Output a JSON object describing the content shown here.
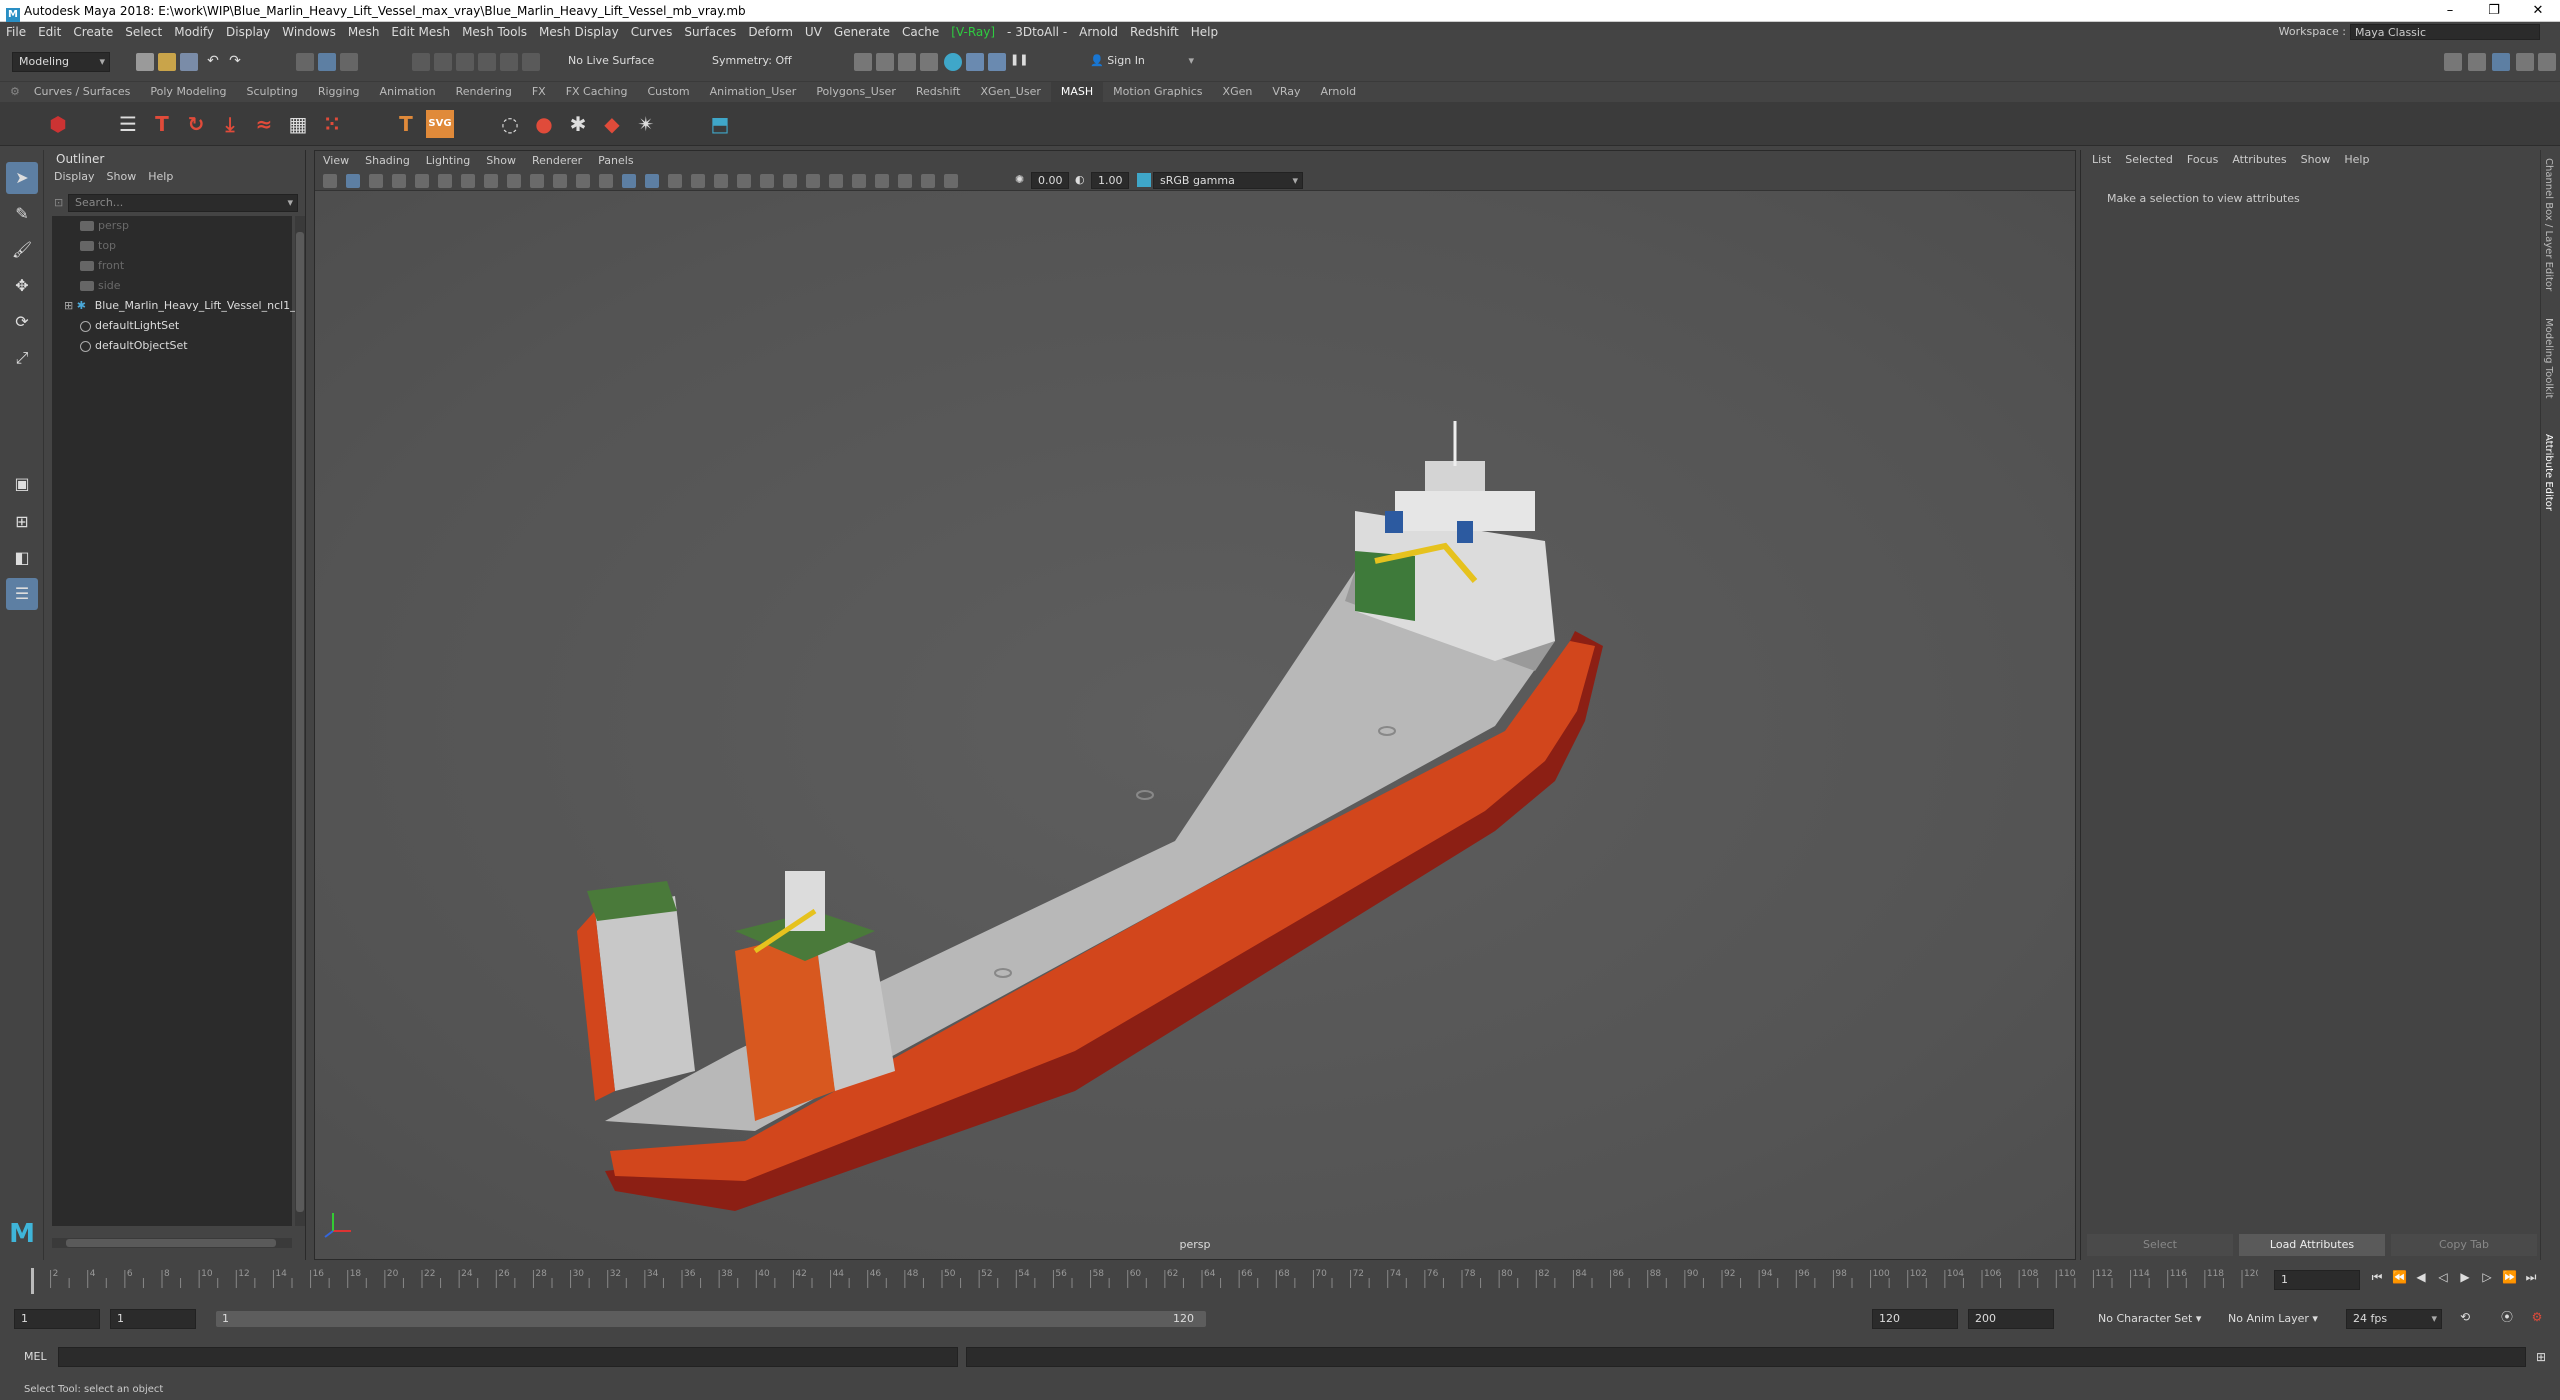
{
  "window": {
    "title": "Autodesk Maya 2018: E:\\work\\WIP\\Blue_Marlin_Heavy_Lift_Vessel_max_vray\\Blue_Marlin_Heavy_Lift_Vessel_mb_vray.mb",
    "minimize": "–",
    "restore": "❐",
    "close": "✕"
  },
  "menubar": {
    "items": [
      "File",
      "Edit",
      "Create",
      "Select",
      "Modify",
      "Display",
      "Windows",
      "Mesh",
      "Edit Mesh",
      "Mesh Tools",
      "Mesh Display",
      "Curves",
      "Surfaces",
      "Deform",
      "UV",
      "Generate",
      "Cache"
    ],
    "vray": "V-Ray",
    "items2": [
      "3DtoAll",
      "Arnold",
      "Redshift",
      "Help"
    ],
    "workspace_label": "Workspace :",
    "workspace_value": "Maya Classic"
  },
  "statusline": {
    "mode": "Modeling",
    "live_surface": "No Live Surface",
    "symmetry": "Symmetry: Off",
    "sign_in": "Sign In"
  },
  "shelf": {
    "tabs": [
      "Curves / Surfaces",
      "Poly Modeling",
      "Sculpting",
      "Rigging",
      "Animation",
      "Rendering",
      "FX",
      "FX Caching",
      "Custom",
      "Animation_User",
      "Polygons_User",
      "Redshift",
      "XGen_User",
      "MASH",
      "Motion Graphics",
      "XGen",
      "VRay",
      "Arnold"
    ],
    "active_tab": "MASH"
  },
  "outliner": {
    "title": "Outliner",
    "menu": [
      "Display",
      "Show",
      "Help"
    ],
    "search_placeholder": "Search...",
    "items": [
      {
        "label": "persp",
        "dim": true,
        "type": "camera"
      },
      {
        "label": "top",
        "dim": true,
        "type": "camera"
      },
      {
        "label": "front",
        "dim": true,
        "type": "camera"
      },
      {
        "label": "side",
        "dim": true,
        "type": "camera"
      },
      {
        "label": "Blue_Marlin_Heavy_Lift_Vessel_ncl1_1",
        "dim": false,
        "type": "group"
      },
      {
        "label": "defaultLightSet",
        "dim": false,
        "type": "set"
      },
      {
        "label": "defaultObjectSet",
        "dim": false,
        "type": "set"
      }
    ]
  },
  "viewport": {
    "menu": [
      "View",
      "Shading",
      "Lighting",
      "Show",
      "Renderer",
      "Panels"
    ],
    "exposure": "0.00",
    "gamma": "1.00",
    "color_space": "sRGB gamma",
    "camera": "persp"
  },
  "attribute_editor": {
    "menu": [
      "List",
      "Selected",
      "Focus",
      "Attributes",
      "Show",
      "Help"
    ],
    "message": "Make a selection to view attributes",
    "buttons": [
      "Select",
      "Load Attributes",
      "Copy Tab"
    ]
  },
  "side_tabs": [
    "Channel Box / Layer Editor",
    "Modeling Toolkit",
    "Attribute Editor"
  ],
  "timeline": {
    "tick_labels": [
      "2",
      "4",
      "6",
      "8",
      "10",
      "12",
      "14",
      "16",
      "18",
      "20",
      "22",
      "24",
      "26",
      "28",
      "30",
      "32",
      "34",
      "36",
      "38",
      "40",
      "42",
      "44",
      "46",
      "48",
      "50",
      "52",
      "54",
      "56",
      "58",
      "60",
      "62",
      "64",
      "66",
      "68",
      "70",
      "72",
      "74",
      "76",
      "78",
      "80",
      "82",
      "84",
      "86",
      "88",
      "90",
      "92",
      "94",
      "96",
      "98",
      "100",
      "102",
      "104",
      "106",
      "108",
      "110",
      "112",
      "114",
      "116",
      "118",
      "120"
    ],
    "start_marker": "1",
    "current_frame": "1"
  },
  "range": {
    "start": "1",
    "anim_start": "1",
    "range_start": "1",
    "range_end": "120",
    "end": "120",
    "anim_end": "200",
    "character_set": "No Character Set",
    "anim_layer": "No Anim Layer",
    "fps": "24 fps"
  },
  "command": {
    "label": "MEL"
  },
  "help_line": "Select Tool: select an object"
}
